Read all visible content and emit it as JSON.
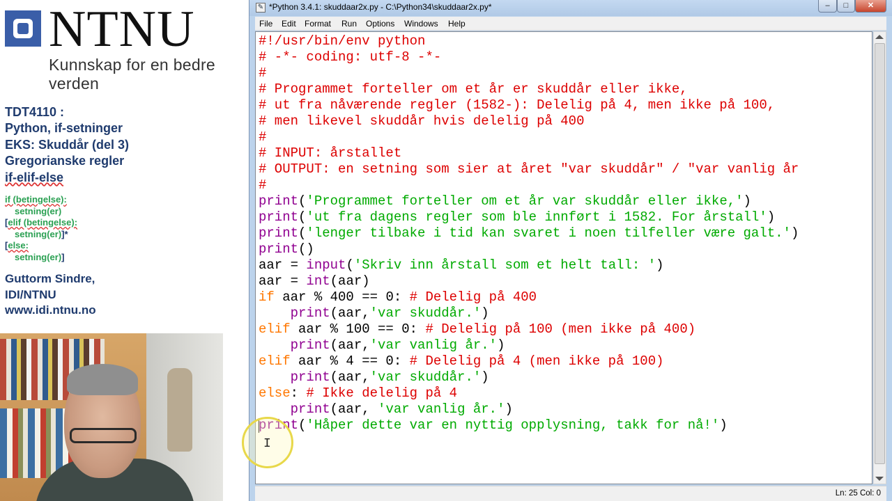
{
  "slide": {
    "logo": "NTNU",
    "tagline": "Kunnskap for en bedre verden",
    "course": [
      "TDT4110 :",
      "Python, if-setninger",
      "EKS: Skuddår (del 3)",
      "Gregorianske regler",
      "if-elif-else"
    ],
    "syntax": {
      "if": "if (betingelse):",
      "if_body": "setning(er)",
      "elif_open": "[",
      "elif": "elif (betingelse):",
      "elif_body": "setning(er)",
      "elif_close": "]*",
      "else_open": "[",
      "else": "else:",
      "else_body": "setning(er)",
      "else_close": "]"
    },
    "author": [
      "Guttorm Sindre,",
      "IDI/NTNU",
      "www.idi.ntnu.no"
    ]
  },
  "window": {
    "title": "*Python 3.4.1: skuddaar2x.py - C:\\Python34\\skuddaar2x.py*",
    "app_icon": "python-file-icon",
    "buttons": {
      "minimize": "–",
      "maximize": "□",
      "close": "✕"
    }
  },
  "menu": [
    "File",
    "Edit",
    "Format",
    "Run",
    "Options",
    "Windows",
    "Help"
  ],
  "code_lines": [
    [
      [
        "c-comment",
        "#!/usr/bin/env python"
      ]
    ],
    [
      [
        "c-comment",
        "# -*- coding: utf-8 -*-"
      ]
    ],
    [
      [
        "c-comment",
        "#"
      ]
    ],
    [
      [
        "c-comment",
        "# Programmet forteller om et år er skuddår eller ikke,"
      ]
    ],
    [
      [
        "c-comment",
        "# ut fra nåværende regler (1582-): Delelig på 4, men ikke på 100,"
      ]
    ],
    [
      [
        "c-comment",
        "# men likevel skuddår hvis delelig på 400"
      ]
    ],
    [
      [
        "c-comment",
        "#"
      ]
    ],
    [
      [
        "c-comment",
        "# INPUT: årstallet"
      ]
    ],
    [
      [
        "c-comment",
        "# OUTPUT: en setning som sier at året \"var skuddår\" / \"var vanlig år"
      ]
    ],
    [
      [
        "c-comment",
        "#"
      ]
    ],
    [
      [
        "c-builtin",
        "print"
      ],
      [
        "c-plain",
        "("
      ],
      [
        "c-string",
        "'Programmet forteller om et år var skuddår eller ikke,'"
      ],
      [
        "c-plain",
        ")"
      ]
    ],
    [
      [
        "c-builtin",
        "print"
      ],
      [
        "c-plain",
        "("
      ],
      [
        "c-string",
        "'ut fra dagens regler som ble innført i 1582. For årstall'"
      ],
      [
        "c-plain",
        ")"
      ]
    ],
    [
      [
        "c-builtin",
        "print"
      ],
      [
        "c-plain",
        "("
      ],
      [
        "c-string",
        "'lenger tilbake i tid kan svaret i noen tilfeller være galt.'"
      ],
      [
        "c-plain",
        ")"
      ]
    ],
    [
      [
        "c-builtin",
        "print"
      ],
      [
        "c-plain",
        "()"
      ]
    ],
    [
      [
        "c-plain",
        "aar = "
      ],
      [
        "c-builtin",
        "input"
      ],
      [
        "c-plain",
        "("
      ],
      [
        "c-string",
        "'Skriv inn årstall som et helt tall: '"
      ],
      [
        "c-plain",
        ")"
      ]
    ],
    [
      [
        "c-plain",
        "aar = "
      ],
      [
        "c-builtin",
        "int"
      ],
      [
        "c-plain",
        "(aar)"
      ]
    ],
    [
      [
        "c-kw",
        "if"
      ],
      [
        "c-plain",
        " aar % 400 == 0: "
      ],
      [
        "c-comment",
        "# Delelig på 400"
      ]
    ],
    [
      [
        "c-plain",
        "    "
      ],
      [
        "c-builtin",
        "print"
      ],
      [
        "c-plain",
        "(aar,"
      ],
      [
        "c-string",
        "'var skuddår.'"
      ],
      [
        "c-plain",
        ")"
      ]
    ],
    [
      [
        "c-kw",
        "elif"
      ],
      [
        "c-plain",
        " aar % 100 == 0: "
      ],
      [
        "c-comment",
        "# Delelig på 100 (men ikke på 400)"
      ]
    ],
    [
      [
        "c-plain",
        "    "
      ],
      [
        "c-builtin",
        "print"
      ],
      [
        "c-plain",
        "(aar,"
      ],
      [
        "c-string",
        "'var vanlig år.'"
      ],
      [
        "c-plain",
        ")"
      ]
    ],
    [
      [
        "c-kw",
        "elif"
      ],
      [
        "c-plain",
        " aar % 4 == 0: "
      ],
      [
        "c-comment",
        "# Delelig på 4 (men ikke på 100)"
      ]
    ],
    [
      [
        "c-plain",
        "    "
      ],
      [
        "c-builtin",
        "print"
      ],
      [
        "c-plain",
        "(aar,"
      ],
      [
        "c-string",
        "'var skuddår.'"
      ],
      [
        "c-plain",
        ")"
      ]
    ],
    [
      [
        "c-kw",
        "else"
      ],
      [
        "c-plain",
        ": "
      ],
      [
        "c-comment",
        "# Ikke delelig på 4"
      ]
    ],
    [
      [
        "c-plain",
        "    "
      ],
      [
        "c-builtin",
        "print"
      ],
      [
        "c-plain",
        "(aar, "
      ],
      [
        "c-string",
        "'var vanlig år.'"
      ],
      [
        "c-plain",
        ")"
      ]
    ],
    [
      [
        "c-builtin",
        "print"
      ],
      [
        "c-plain",
        "("
      ],
      [
        "c-string",
        "'Håper dette var en nyttig opplysning, takk for nå!'"
      ],
      [
        "c-plain",
        ")"
      ]
    ]
  ],
  "status": "Ln: 25 Col: 0",
  "colors": {
    "comment": "#dd0000",
    "keyword": "#ff7700",
    "builtin": "#900090",
    "string": "#00aa00",
    "slide_text": "#1f3b6e",
    "syntax_text": "#2aa052"
  }
}
